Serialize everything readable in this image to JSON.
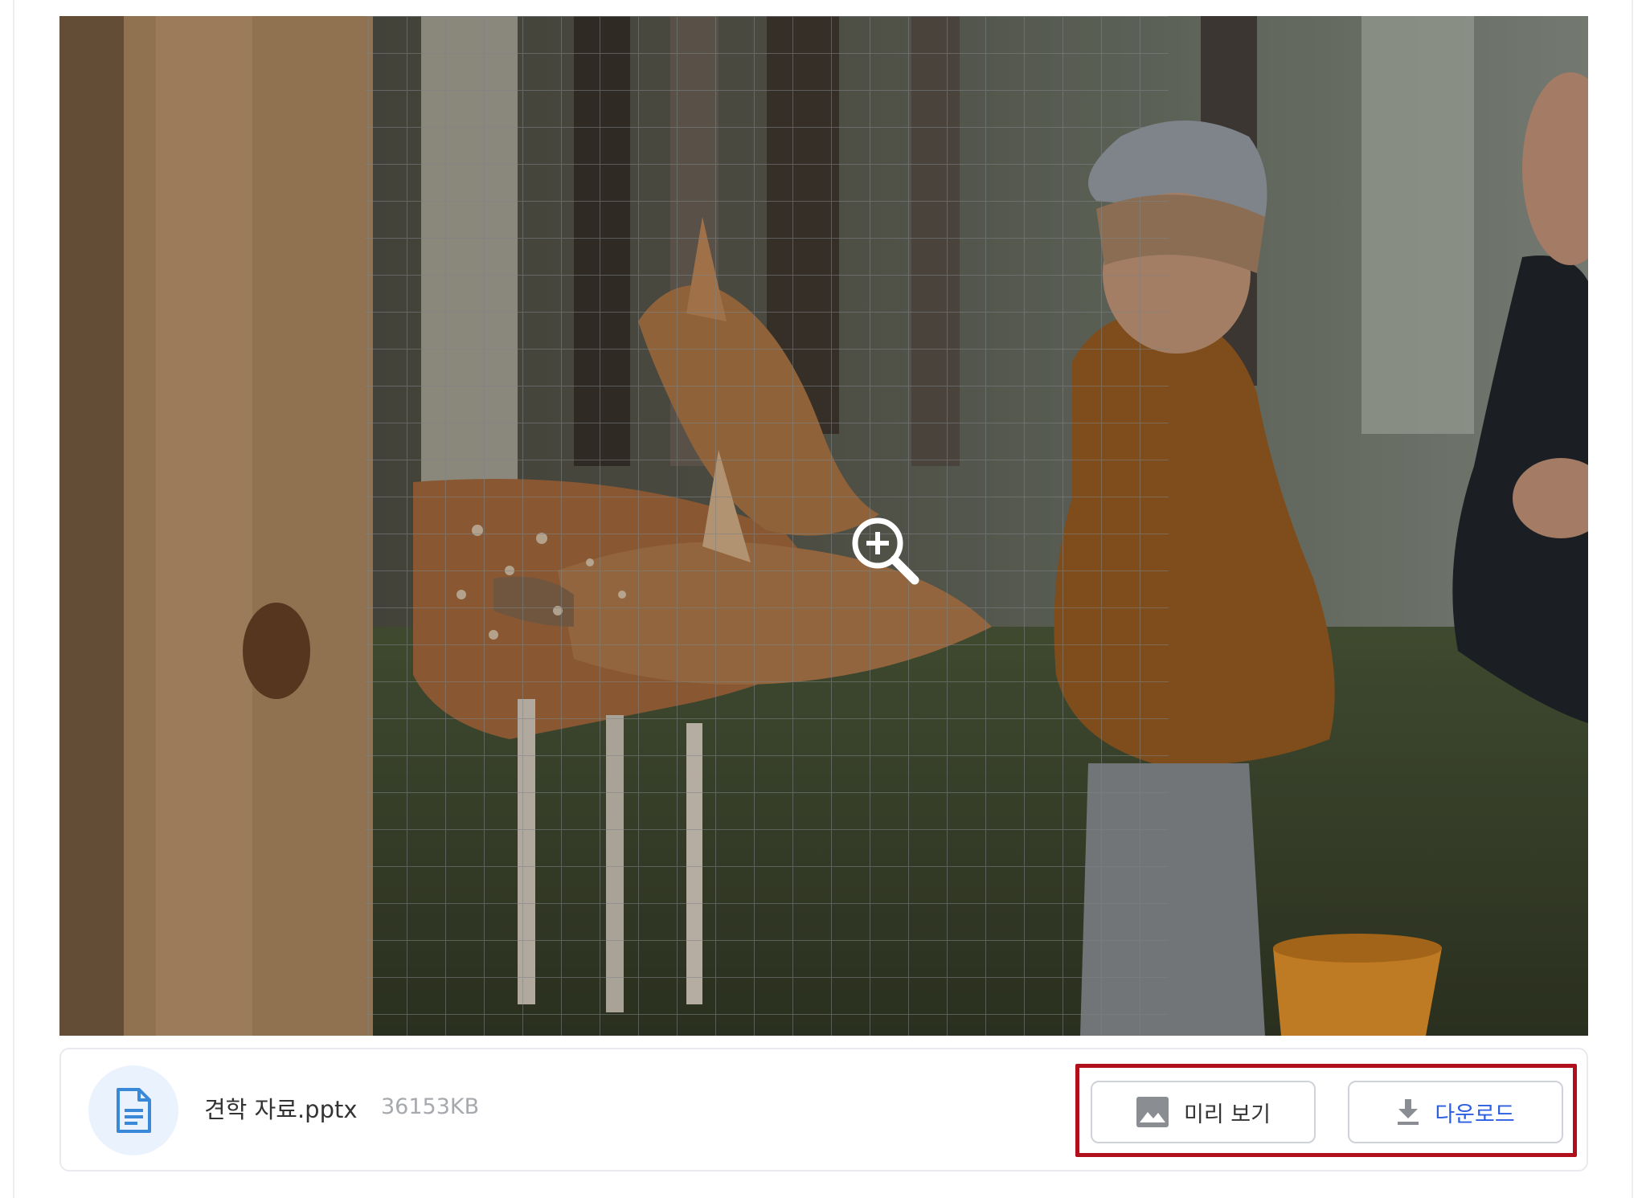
{
  "attachment": {
    "file_name": "견학 자료.pptx",
    "file_size": "36153KB",
    "preview_label": "미리 보기",
    "download_label": "다운로드"
  },
  "image": {
    "zoom_icon": "zoom-in-icon",
    "photo_subject": "child-feeding-deer-photo"
  },
  "icons": {
    "file": "document-icon",
    "preview": "image-icon",
    "download": "download-icon"
  },
  "colors": {
    "highlight_border": "#b0101c",
    "download_text": "#2b5fe0",
    "file_icon": "#3a88d8",
    "file_icon_bg": "#eaf3fd"
  }
}
